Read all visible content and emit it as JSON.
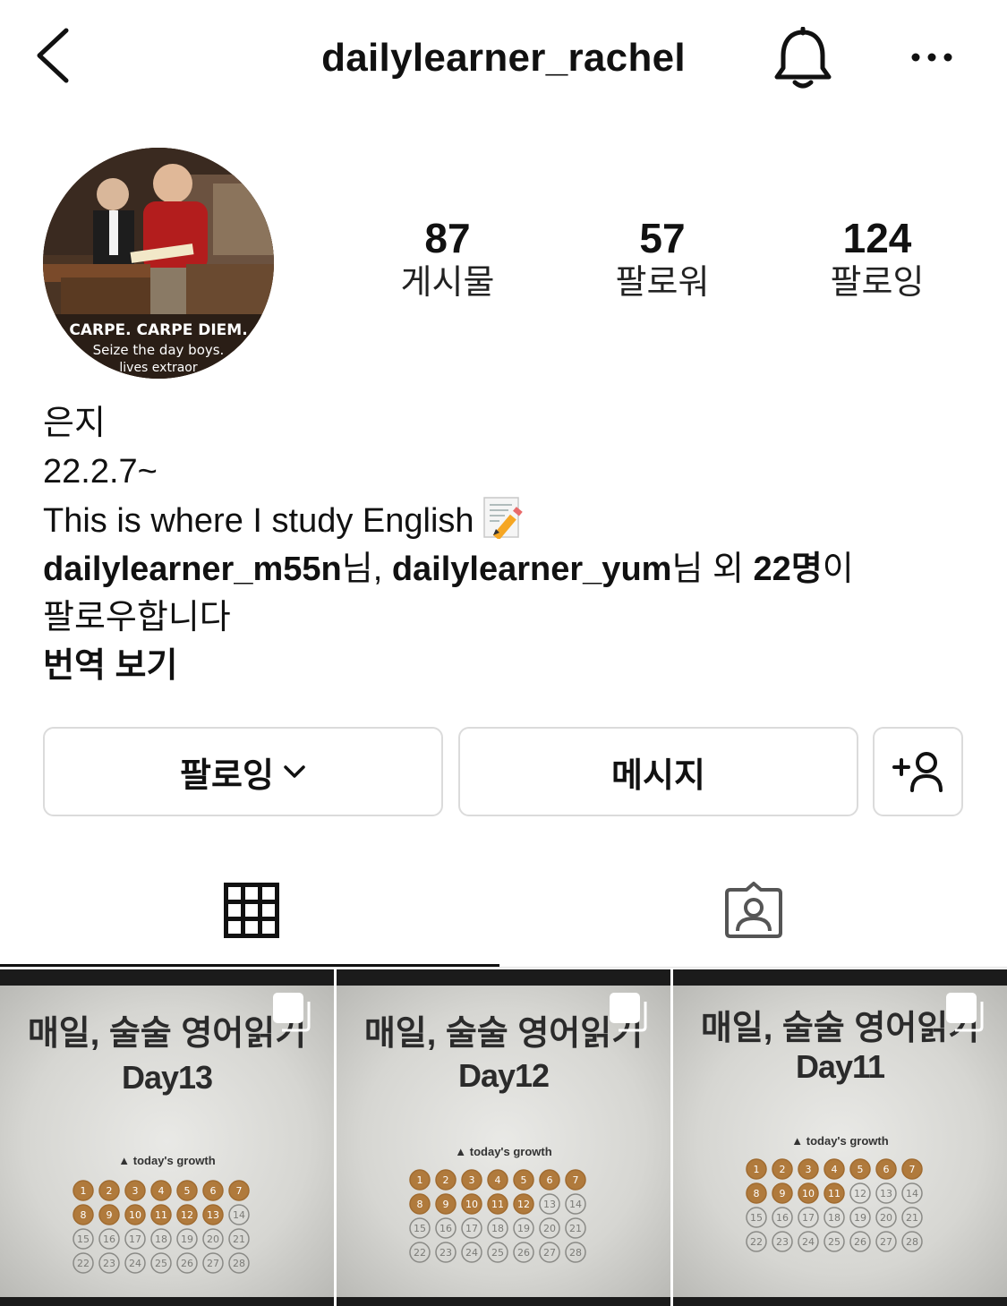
{
  "header": {
    "handle": "dailylearner_rachel",
    "back_icon": "chevron-left-icon",
    "bell_icon": "bell-icon",
    "more_icon": "more-horizontal-icon"
  },
  "avatar": {
    "caption_line1": "CARPE. CARPE DIEM.",
    "caption_line2": "Seize the day boys.",
    "caption_line3": "lives extraor"
  },
  "stats": [
    {
      "value": "87",
      "label": "게시물"
    },
    {
      "value": "57",
      "label": "팔로워"
    },
    {
      "value": "124",
      "label": "팔로잉"
    }
  ],
  "bio": {
    "name": "은지",
    "line1": "22.2.7~",
    "line2": "This is where I study English",
    "line2_emoji": "memo-pencil-emoji",
    "followed_by_user1": "dailylearner_m55n",
    "followed_by_suffix1": "님, ",
    "followed_by_user2": "dailylearner_yum",
    "followed_by_suffix2": "님 외 ",
    "followed_by_count": "22명",
    "followed_by_suffix3": "이",
    "followed_by_line2": "팔로우합니다",
    "translate": "번역 보기"
  },
  "buttons": {
    "follow": "팔로잉",
    "message": "메시지",
    "add_user_icon": "add-user-icon"
  },
  "tabs": [
    {
      "name": "grid",
      "icon": "grid-icon",
      "active": true
    },
    {
      "name": "tagged",
      "icon": "tagged-person-icon",
      "active": false
    }
  ],
  "posts": [
    {
      "title": "매일, 술술 영어읽기",
      "day": "Day13",
      "brand": "today's growth",
      "completed": 13
    },
    {
      "title": "매일, 술술 영어읽기",
      "day": "Day12",
      "brand": "today's growth",
      "completed": 12
    },
    {
      "title": "매일, 술술 영어읽기",
      "day": "Day11",
      "brand": "today's growth",
      "completed": 11
    }
  ]
}
